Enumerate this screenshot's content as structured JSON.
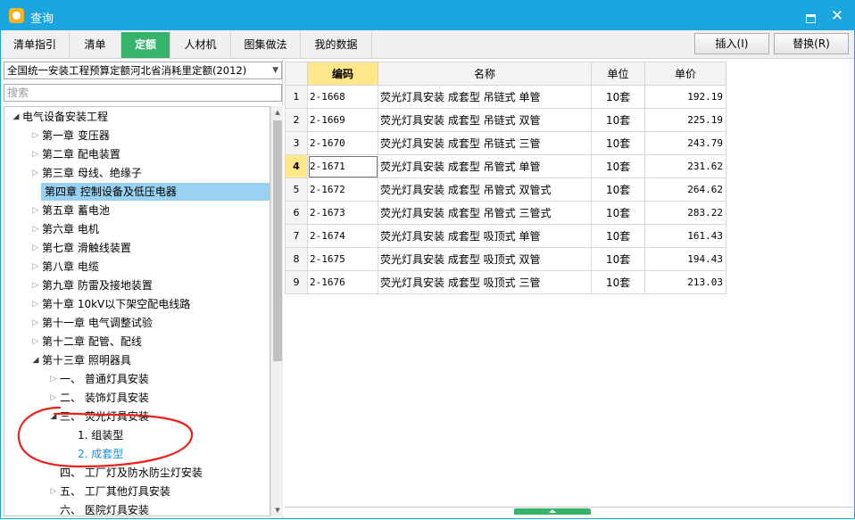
{
  "window": {
    "title": "查询"
  },
  "tabs": [
    {
      "label": "清单指引"
    },
    {
      "label": "清单"
    },
    {
      "label": "定额",
      "active": true
    },
    {
      "label": "人材机"
    },
    {
      "label": "图集做法"
    },
    {
      "label": "我的数据"
    }
  ],
  "toolbar": {
    "insert_label": "插入(I)",
    "replace_label": "替换(R)"
  },
  "library": {
    "selected": "全国统一安装工程预算定额河北省消耗里定额(2012)"
  },
  "search": {
    "placeholder": "搜索"
  },
  "tree": [
    {
      "label": "电气设备安装工程",
      "level": 0,
      "state": "open"
    },
    {
      "label": "第一章 变压器",
      "level": 1,
      "state": "closed"
    },
    {
      "label": "第二章 配电装置",
      "level": 1,
      "state": "closed"
    },
    {
      "label": "第三章 母线、绝缘子",
      "level": 1,
      "state": "closed"
    },
    {
      "label": "第四章 控制设备及低压电器",
      "level": 1,
      "state": "closed",
      "selected": true
    },
    {
      "label": "第五章 蓄电池",
      "level": 1,
      "state": "closed"
    },
    {
      "label": "第六章 电机",
      "level": 1,
      "state": "closed"
    },
    {
      "label": "第七章 滑触线装置",
      "level": 1,
      "state": "closed"
    },
    {
      "label": "第八章 电缆",
      "level": 1,
      "state": "closed"
    },
    {
      "label": "第九章 防雷及接地装置",
      "level": 1,
      "state": "closed"
    },
    {
      "label": "第十章 10kV以下架空配电线路",
      "level": 1,
      "state": "closed"
    },
    {
      "label": "第十一章 电气调整试验",
      "level": 1,
      "state": "closed"
    },
    {
      "label": "第十二章 配管、配线",
      "level": 1,
      "state": "closed"
    },
    {
      "label": "第十三章 照明器具",
      "level": 1,
      "state": "open"
    },
    {
      "label": "一、 普通灯具安装",
      "level": 2,
      "state": "closed"
    },
    {
      "label": "二、 装饰灯具安装",
      "level": 2,
      "state": "closed"
    },
    {
      "label": "三、 荧光灯具安装",
      "level": 2,
      "state": "open"
    },
    {
      "label": "1. 组装型",
      "level": 3,
      "state": "none"
    },
    {
      "label": "2. 成套型",
      "level": 3,
      "state": "none",
      "current": true
    },
    {
      "label": "四、 工厂灯及防水防尘灯安装",
      "level": 2,
      "state": "none"
    },
    {
      "label": "五、 工厂其他灯具安装",
      "level": 2,
      "state": "closed"
    },
    {
      "label": "六、 医院灯具安装",
      "level": 2,
      "state": "none"
    }
  ],
  "grid": {
    "headers": {
      "code": "编码",
      "name": "名称",
      "unit": "单位",
      "price": "单价"
    },
    "current_row": 4,
    "rows": [
      {
        "num": "1",
        "code": "2-1668",
        "name": "荧光灯具安装 成套型 吊链式 单管",
        "unit": "10套",
        "price": "192.19"
      },
      {
        "num": "2",
        "code": "2-1669",
        "name": "荧光灯具安装 成套型 吊链式 双管",
        "unit": "10套",
        "price": "225.19"
      },
      {
        "num": "3",
        "code": "2-1670",
        "name": "荧光灯具安装 成套型 吊链式 三管",
        "unit": "10套",
        "price": "243.79"
      },
      {
        "num": "4",
        "code": "2-1671",
        "name": "荧光灯具安装 成套型 吊管式 单管",
        "unit": "10套",
        "price": "231.62"
      },
      {
        "num": "5",
        "code": "2-1672",
        "name": "荧光灯具安装 成套型 吊管式 双管式",
        "unit": "10套",
        "price": "264.62"
      },
      {
        "num": "6",
        "code": "2-1673",
        "name": "荧光灯具安装 成套型 吊管式 三管式",
        "unit": "10套",
        "price": "283.22"
      },
      {
        "num": "7",
        "code": "2-1674",
        "name": "荧光灯具安装 成套型 吸顶式 单管",
        "unit": "10套",
        "price": "161.43"
      },
      {
        "num": "8",
        "code": "2-1675",
        "name": "荧光灯具安装 成套型 吸顶式 双管",
        "unit": "10套",
        "price": "194.43"
      },
      {
        "num": "9",
        "code": "2-1676",
        "name": "荧光灯具安装 成套型 吸顶式 三管",
        "unit": "10套",
        "price": "213.03"
      }
    ]
  },
  "annotation": {
    "color": "#e8231c"
  },
  "colors": {
    "titlebar": "#1ba6e0",
    "active_tab": "#36b46b",
    "selection": "#99d1f2",
    "header_highlight": "#ffe78a",
    "link_blue": "#1a8ee0"
  }
}
